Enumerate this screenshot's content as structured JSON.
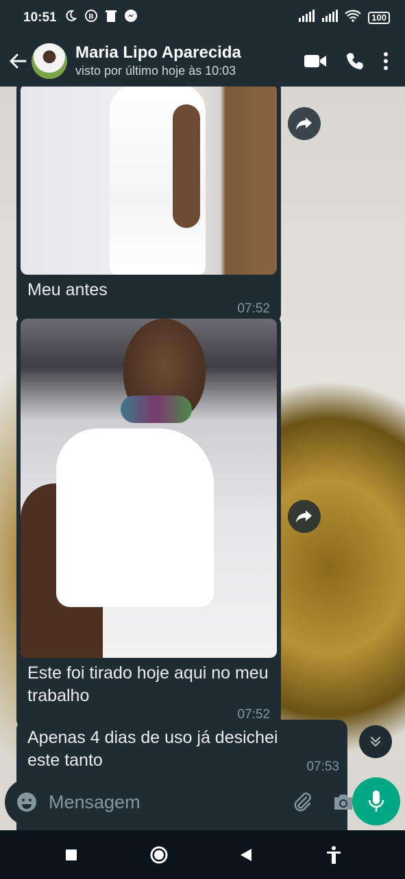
{
  "status_bar": {
    "time": "10:51",
    "battery": "100"
  },
  "header": {
    "contact_name": "Maria Lipo Aparecida",
    "last_seen": "visto por último hoje às 10:03"
  },
  "messages": [
    {
      "type": "image",
      "caption": "Meu antes",
      "time": "07:52"
    },
    {
      "type": "image",
      "caption": "Este foi tirado hoje aqui no meu trabalho",
      "time": "07:52"
    },
    {
      "type": "text",
      "text": "Apenas 4 dias de uso já desichei este tanto",
      "time": "07:53"
    }
  ],
  "composer": {
    "placeholder": "Mensagem"
  },
  "colors": {
    "bubble": "#1f2c34",
    "accent": "#00a884",
    "time_text": "#8696a0"
  }
}
